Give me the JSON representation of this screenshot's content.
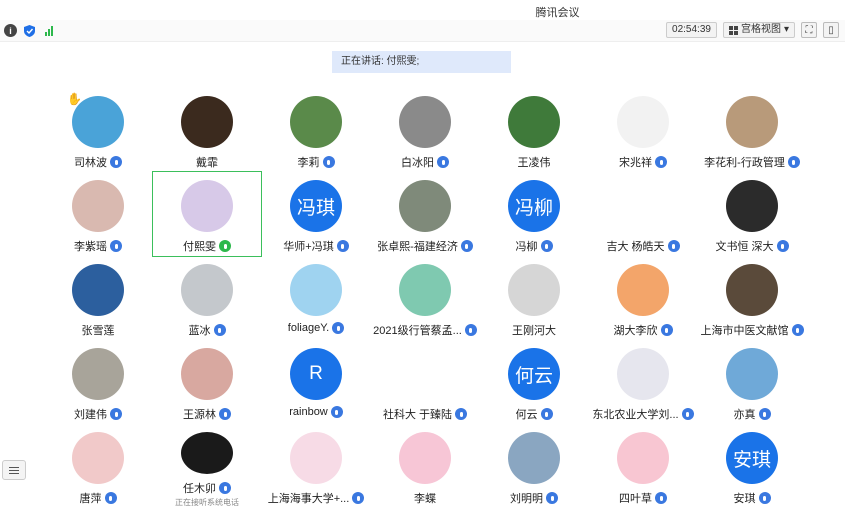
{
  "window": {
    "title": "腾讯会议"
  },
  "toolbar": {
    "timer": "02:54:39",
    "view_label": "宫格视图"
  },
  "speaking": {
    "text": "正在讲话: 付熙雯;"
  },
  "participants": [
    {
      "name": "司林波",
      "mic": "on",
      "hand": true,
      "avatar_text": "",
      "color": "#4aa3d8"
    },
    {
      "name": "戴霏",
      "mic": "none",
      "avatar_text": "",
      "color": "#3b2a1e"
    },
    {
      "name": "李莉",
      "mic": "on",
      "avatar_text": "",
      "color": "#5a8a4a"
    },
    {
      "name": "白冰阳",
      "mic": "on",
      "avatar_text": "",
      "color": "#8a8a8a"
    },
    {
      "name": "王凌伟",
      "mic": "none",
      "avatar_text": "",
      "color": "#3f7a3a"
    },
    {
      "name": "宋兆祥",
      "mic": "on",
      "avatar_text": "",
      "color": "#f2f2f2"
    },
    {
      "name": "李花利-行政管理",
      "mic": "on",
      "avatar_text": "",
      "color": "#b89a7a"
    },
    {
      "name": "李紫瑶",
      "mic": "on",
      "avatar_text": "",
      "color": "#d9b9b0"
    },
    {
      "name": "付熙雯",
      "mic": "active",
      "selected": true,
      "avatar_text": "",
      "color": "#d7c9e8"
    },
    {
      "name": "华师+冯琪",
      "mic": "on",
      "avatar_text": "冯琪",
      "color": "#1a73e8"
    },
    {
      "name": "张卓熙-福建经济",
      "mic": "on",
      "avatar_text": "",
      "color": "#7f8a7a"
    },
    {
      "name": "冯柳",
      "mic": "on",
      "avatar_text": "冯柳",
      "color": "#1a73e8"
    },
    {
      "name": "吉大 杨皓天",
      "mic": "on",
      "avatar_text": "",
      "color": "#ffffff"
    },
    {
      "name": "文书恒 深大",
      "mic": "on",
      "avatar_text": "",
      "color": "#2b2b2b"
    },
    {
      "name": "张雪莲",
      "mic": "none",
      "avatar_text": "",
      "color": "#2c5f9e"
    },
    {
      "name": "蓝冰",
      "mic": "on",
      "avatar_text": "",
      "color": "#c4c8cc"
    },
    {
      "name": "foliageY.",
      "mic": "on",
      "avatar_text": "",
      "color": "#9fd3f0"
    },
    {
      "name": "2021级行管蔡孟...",
      "mic": "on",
      "avatar_text": "",
      "color": "#7fc9b0"
    },
    {
      "name": "王刚河大",
      "mic": "none",
      "avatar_text": "",
      "color": "#d6d6d6"
    },
    {
      "name": "湖大李欣",
      "mic": "on",
      "avatar_text": "",
      "color": "#f3a56a"
    },
    {
      "name": "上海市中医文献馆",
      "mic": "on",
      "avatar_text": "",
      "color": "#5a4a3a"
    },
    {
      "name": "刘建伟",
      "mic": "on",
      "avatar_text": "",
      "color": "#a8a49a"
    },
    {
      "name": "王源林",
      "mic": "on",
      "avatar_text": "",
      "color": "#d8a8a0"
    },
    {
      "name": "rainbow",
      "mic": "on",
      "avatar_text": "R",
      "color": "#1a73e8"
    },
    {
      "name": "社科大 于臻陆",
      "mic": "on",
      "avatar_text": "",
      "color": "#ffffff"
    },
    {
      "name": "何云",
      "mic": "on",
      "avatar_text": "何云",
      "color": "#1a73e8"
    },
    {
      "name": "东北农业大学刘...",
      "mic": "on",
      "avatar_text": "",
      "color": "#e6e6ee"
    },
    {
      "name": "亦真",
      "mic": "on",
      "avatar_text": "",
      "color": "#6fa9d8"
    },
    {
      "name": "唐萍",
      "mic": "on",
      "avatar_text": "",
      "color": "#f1c9c9"
    },
    {
      "name": "任木卯",
      "mic": "on",
      "avatar_text": "",
      "color": "#1a1a1a",
      "subtext": "正在接听系统电话"
    },
    {
      "name": "上海海事大学+...",
      "mic": "on",
      "avatar_text": "",
      "color": "#f7dbe6"
    },
    {
      "name": "李蝶",
      "mic": "none",
      "avatar_text": "",
      "color": "#f7c6d6"
    },
    {
      "name": "刘明明",
      "mic": "on",
      "avatar_text": "",
      "color": "#8aa6c1"
    },
    {
      "name": "四叶草",
      "mic": "on",
      "avatar_text": "",
      "color": "#f8c6d2"
    },
    {
      "name": "安琪",
      "mic": "on",
      "avatar_text": "安琪",
      "color": "#1a73e8"
    }
  ]
}
